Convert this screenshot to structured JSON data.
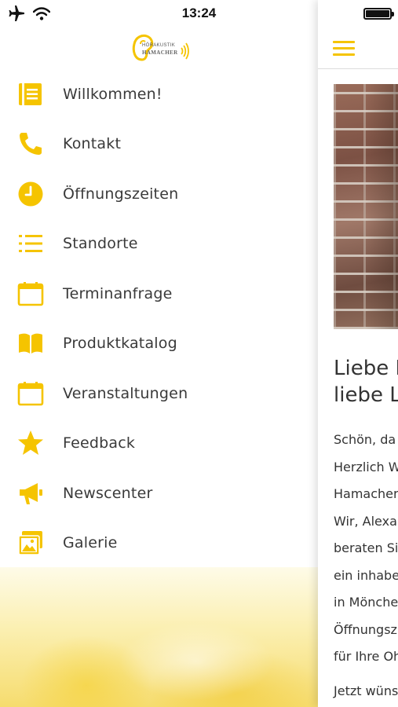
{
  "statusbar": {
    "time": "13:24",
    "left_icons": [
      "airplane-icon",
      "wifi-icon"
    ],
    "battery_level": 1.0
  },
  "brand": {
    "logo_line1": "HÖRAKUSTIK",
    "logo_line2": "HAMACHER",
    "accent_color": "#F5C400"
  },
  "menu": {
    "items": [
      {
        "label": "Willkommen!",
        "icon": "document-icon"
      },
      {
        "label": "Kontakt",
        "icon": "phone-icon"
      },
      {
        "label": "Öffnungszeiten",
        "icon": "clock-icon"
      },
      {
        "label": "Standorte",
        "icon": "list-icon"
      },
      {
        "label": "Terminanfrage",
        "icon": "calendar-icon"
      },
      {
        "label": "Produktkatalog",
        "icon": "book-icon"
      },
      {
        "label": "Veranstaltungen",
        "icon": "calendar-icon"
      },
      {
        "label": "Feedback",
        "icon": "star-icon"
      },
      {
        "label": "Newscenter",
        "icon": "megaphone-icon"
      },
      {
        "label": "Galerie",
        "icon": "gallery-icon"
      }
    ]
  },
  "content": {
    "heading_lines": [
      "Liebe L",
      "liebe L"
    ],
    "paragraph_lines": [
      "Schön, da",
      "Herzlich W",
      "Hamacher",
      "Wir, Alexa",
      "beraten Si",
      "ein inhabe",
      "in Mönche",
      "Öffnungsz",
      "für Ihre Oh"
    ],
    "paragraph2": "Jetzt wüns"
  }
}
